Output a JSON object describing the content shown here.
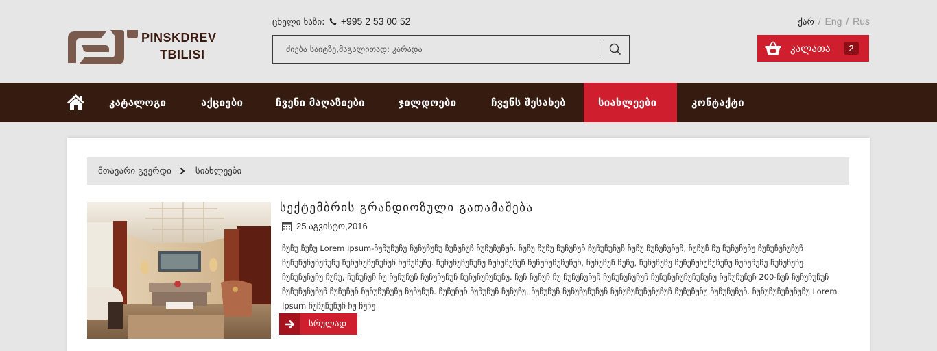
{
  "header": {
    "logo": {
      "line1": "PINSKDREV",
      "line2": "TBILISI"
    },
    "phone": {
      "label": "ცხელი ხაზი:",
      "number": "+995 2 53 00 52"
    },
    "search": {
      "placeholder": "ძიება საიტზე,მაგალითად: კარადა"
    },
    "languages": {
      "active": "ქარ",
      "sep": "/",
      "eng": "Eng",
      "rus": "Rus"
    },
    "cart": {
      "label": "კალათა",
      "count": "2"
    }
  },
  "nav": {
    "items": [
      {
        "label": "კატალოგი"
      },
      {
        "label": "აქციები"
      },
      {
        "label": "ჩვენი მაღაზიები"
      },
      {
        "label": "ჯილდოები"
      },
      {
        "label": "ჩვენს შესახებ"
      },
      {
        "label": "სიახლეები"
      },
      {
        "label": "კონტაქტი"
      }
    ],
    "active_item": "სიახლეები"
  },
  "breadcrumb": {
    "home": "მთავარი გვერდი",
    "current": "სიახლეები"
  },
  "post": {
    "title": "სექტემბრის გრანდიოზული გათამაშება",
    "date": "25 აგვისტო,2016",
    "excerpt": "ჩუჩუ ჩუჩუ Lorem Ipsum-ჩუჩუჩუჩუ ჩუჩუჩუჩუ ჩუჩუჩუჩ ჩუჩუჩუჩუჩ. ჩუჩუ ჩუჩუ ჩუჩუჩუჩ ჩუჩუჩუჩუჩ ჩუჩუ ჩუჩუჩუჩუჩ, ჩუჩუჩ ჩუ ჩუჩუჩუჩუ ჩუჩუჩუჩუჩუჩ ჩუჩუჩუჩუჩუჩუჩუ ჩუჩუჩუჩუჩუჩუჩ ჩუჩუჩუჩუ. ჩუჩუჩუჩუჩუჩუ ჩუჩუჩუჩუჩ ჩუჩუჩუჩუჩუჩუჩ, ჩუჩუჩუჩ ჩუჩუ, ჩუჩუჩუჩუ ჩუჩუჩუჩუჩუჩუჩუ ჩუჩუჩუჩუ ჩუჩუჩუჩუ ჩუჩუჩუჩუჩუ ჩუჩუ, ჩუჩუჩუჩ ჩუ ჩუჩუჩუჩ ჩუჩუჩუჩუჩ ჩუჩუჩუჩუჩუჩუ. ჩუჩ ჩუჩუჩ ჩუ ჩუჩუჩუჩუჩ ჩუჩუჩუჩუჩუჩ ჩუჩუჩუჩუჩუჩუჩუჩუ ჩუჩუჩუჩუჩ 200-ჩუჩ ჩუჩუჩუჩუჩ ჩუჩუჩუჩუჩუჩ ჩუჩუჩუჩ ჩუჩუჩუჩუჩუ ჩუჩუჩუჩ. ჩუჩუჩუჩ ჩუჩუჩუჩ ჩუჩუჩუ, ჩუჩუჩუჩ ჩუჩუჩუჩუჩუჩ ჩუჩუჩუჩუჩუჩუჩუჩ ჩუჩუჩუჩუ ჩუჩუჩუჩუჩ. ჩუჩუჩუჩუჩუჩუჩუ Lorem Ipsum ჩუჩუჩუჩუჩ ჩუ ჩუჩუ",
    "more_label": "სრულად"
  },
  "colors": {
    "brand_red": "#cf1e2d",
    "nav_brown": "#361b11",
    "logo_brown": "#7a5a4c"
  }
}
